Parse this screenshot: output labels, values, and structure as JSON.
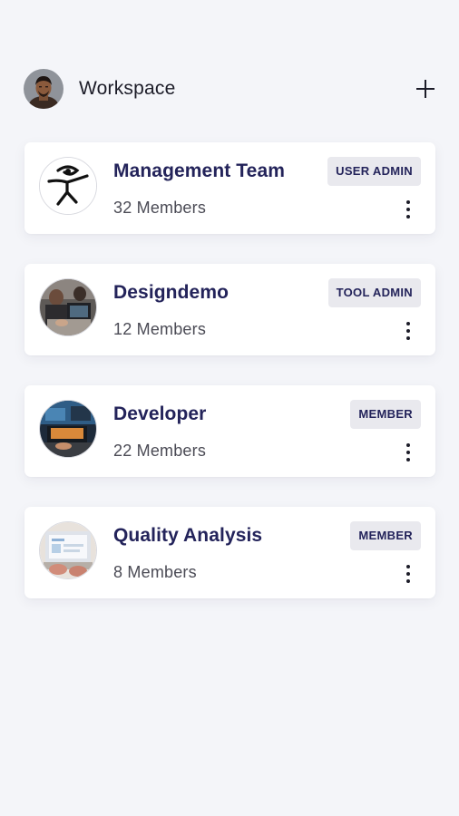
{
  "header": {
    "title": "Workspace",
    "avatar_icon": "user-avatar",
    "add_icon": "plus-icon"
  },
  "teams": [
    {
      "name": "Management Team",
      "members": "32 Members",
      "role": "USER ADMIN",
      "icon": "logo-figure-icon"
    },
    {
      "name": "Designdemo",
      "members": "12 Members",
      "role": "TOOL ADMIN",
      "icon": "team-photo"
    },
    {
      "name": "Developer",
      "members": "22 Members",
      "role": "MEMBER",
      "icon": "team-photo"
    },
    {
      "name": "Quality Analysis",
      "members": "8 Members",
      "role": "MEMBER",
      "icon": "team-photo"
    }
  ],
  "colors": {
    "background": "#f4f5f9",
    "card": "#ffffff",
    "title_text": "#23235a",
    "badge_bg": "#e9e9ee"
  }
}
